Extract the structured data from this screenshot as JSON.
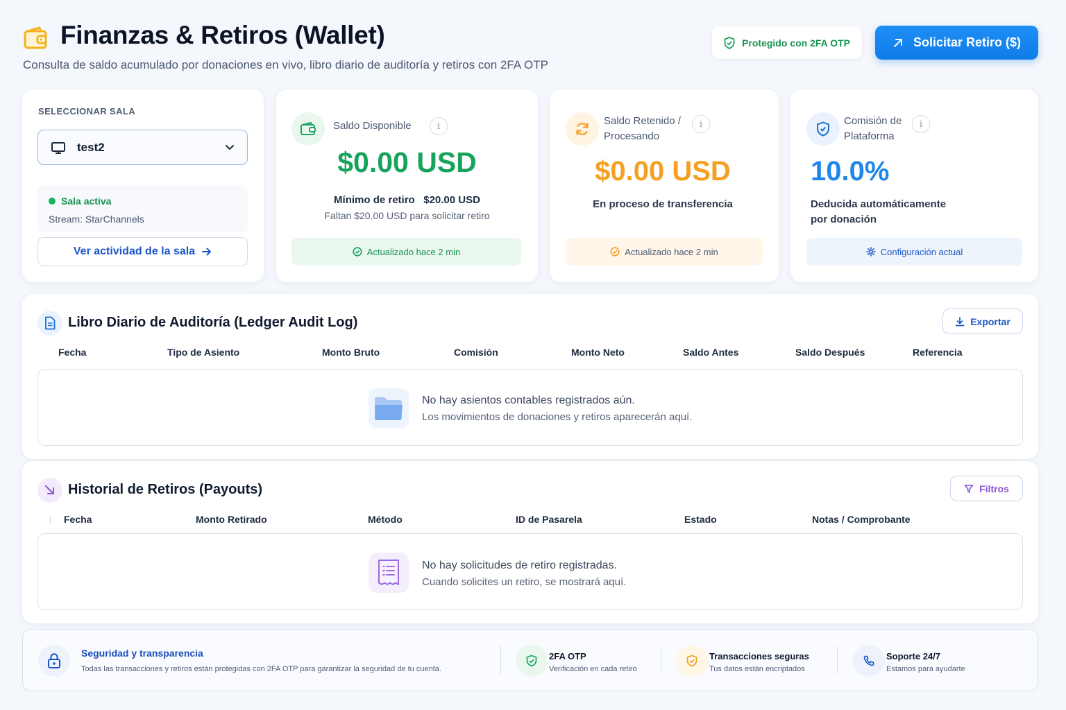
{
  "header": {
    "title": "Finanzas & Retiros (Wallet)",
    "subtitle": "Consulta de saldo acumulado por donaciones en vivo, libro diario de auditoría y retiros con 2FA OTP",
    "security_chip": "Protegido con 2FA OTP",
    "withdraw_button": "Solicitar Retiro ($)"
  },
  "room": {
    "label": "SELECCIONAR SALA",
    "selected": "test2",
    "status": "Sala activa",
    "stream": "Stream: StarChannels",
    "activity_link": "Ver actividad de la sala"
  },
  "available": {
    "title": "Saldo Disponible",
    "amount": "$0.00 USD",
    "min_label": "Mínimo de retiro",
    "min_value": "$20.00 USD",
    "remaining": "Faltan $20.00 USD para solicitar retiro",
    "updated": "Actualizado hace 2 min"
  },
  "held": {
    "title_line1": "Saldo Retenido /",
    "title_line2": "Procesando",
    "amount": "$0.00 USD",
    "note": "En proceso de transferencia",
    "updated": "Actualizado hace 2 min"
  },
  "fee": {
    "title_line1": "Comisión de",
    "title_line2": "Plataforma",
    "value": "10.0%",
    "note_line1": "Deducida automáticamente",
    "note_line2": "por donación",
    "config": "Configuración actual"
  },
  "ledger": {
    "title": "Libro Diario de Auditoría (Ledger Audit Log)",
    "export_button": "Exportar",
    "columns": [
      "Fecha",
      "Tipo de Asiento",
      "Monto Bruto",
      "Comisión",
      "Monto Neto",
      "Saldo Antes",
      "Saldo Después",
      "Referencia"
    ],
    "empty_title": "No hay asientos contables registrados aún.",
    "empty_sub": "Los movimientos de donaciones y retiros aparecerán aquí."
  },
  "payouts": {
    "title": "Historial de Retiros (Payouts)",
    "filter_button": "Filtros",
    "columns": [
      "Fecha",
      "Monto Retirado",
      "Método",
      "ID de Pasarela",
      "Estado",
      "Notas / Comprobante"
    ],
    "empty_title": "No hay solicitudes de retiro registradas.",
    "empty_sub": "Cuando solicites un retiro, se mostrará aquí."
  },
  "security": {
    "title": "Seguridad y transparencia",
    "sub": "Todas las transacciones y retiros están protegidas con 2FA OTP para garantizar la seguridad de tu cuenta.",
    "items": [
      {
        "title": "2FA OTP",
        "sub": "Verificación en cada retiro"
      },
      {
        "title": "Transacciones seguras",
        "sub": "Tus datos están encriptados"
      },
      {
        "title": "Soporte 24/7",
        "sub": "Estamos para ayudarte"
      }
    ]
  },
  "colors": {
    "accent": "#1283ee",
    "green": "#17a35c",
    "orange": "#f5a023",
    "blue_value": "#1f87ec",
    "purple": "#8b52d6"
  }
}
